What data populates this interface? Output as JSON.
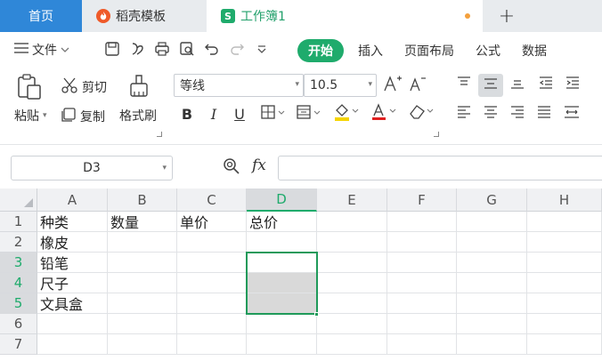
{
  "titlebar": {
    "home_tab": "首页",
    "template_tab": "稻壳模板",
    "workbook_tab": "工作簿1",
    "workbook_logo": "S",
    "new_tab": "+"
  },
  "menubar": {
    "file_label": "文件",
    "tabs": [
      "开始",
      "插入",
      "页面布局",
      "公式",
      "数据"
    ],
    "active_tab": "开始"
  },
  "ribbon": {
    "paste_label": "粘贴",
    "cut_label": "剪切",
    "copy_label": "复制",
    "format_painter_label": "格式刷",
    "font_name": "等线",
    "font_size": "10.5",
    "bold": "B",
    "italic": "I",
    "underline": "U",
    "font_color_glyph": "A",
    "grow_font": "A⁺",
    "shrink_font": "A⁻"
  },
  "formula_bar": {
    "cell_ref": "D3",
    "fx": "fx",
    "formula": ""
  },
  "grid": {
    "columns": [
      "A",
      "B",
      "C",
      "D",
      "E",
      "F",
      "G",
      "H"
    ],
    "selected_column": "D",
    "rows": [
      "1",
      "2",
      "3",
      "4",
      "5",
      "6",
      "7"
    ],
    "selected_rows": [
      "3",
      "4",
      "5"
    ],
    "cells": {
      "A1": "种类",
      "B1": "数量",
      "C1": "单价",
      "D1": "总价",
      "A2": "橡皮",
      "A3": "铅笔",
      "A4": "尺子",
      "A5": "文具盒"
    },
    "selection": "D3:D5",
    "selection_color": "#1f9a5a"
  },
  "colors": {
    "accent_green": "#1fab6c",
    "home_tab_blue": "#2f87d8",
    "daoke_orange": "#ef5a29"
  }
}
